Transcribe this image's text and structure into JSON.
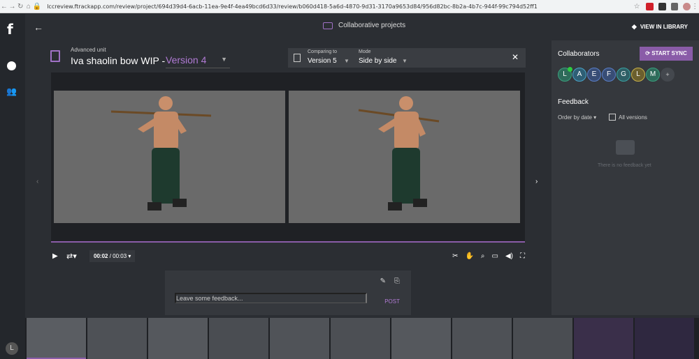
{
  "browser": {
    "url": "lccreview.ftrackapp.com/review/project/694d39d4-6acb-11ea-9e4f-4ea49bcd6d33/review/b060d418-5a6d-4870-9d31-3170a9653d84/956d82bc-8b2a-4b7c-944f-99c794d52ff1"
  },
  "app": {
    "logo": "f",
    "user_initial": "L"
  },
  "topbar": {
    "back_label": "←",
    "center_title": "Collaborative projects",
    "view_in_library": "VIEW IN LIBRARY"
  },
  "header": {
    "breadcrumb": "Advanced unit",
    "title": "Iva shaolin bow WIP -",
    "version": "Version 4"
  },
  "compare": {
    "comparing_label": "Comparing to",
    "comparing_value": "Version 5",
    "mode_label": "Mode",
    "mode_value": "Side by side",
    "close": "✕"
  },
  "controls": {
    "current_time": "00:02",
    "total_time": "/ 00:03"
  },
  "feedback_box": {
    "placeholder": "Leave some feedback...",
    "post_label": "POST"
  },
  "right_panel": {
    "collaborators_title": "Collaborators",
    "start_sync_label": "START SYNC",
    "avatars": [
      {
        "initial": "L",
        "color": "#3aa17e",
        "bg": "#2e6b5a",
        "online": true
      },
      {
        "initial": "A",
        "color": "#4aa3c8",
        "bg": "#2f5f75"
      },
      {
        "initial": "E",
        "color": "#5a7fc8",
        "bg": "#384d75"
      },
      {
        "initial": "F",
        "color": "#5a7fc8",
        "bg": "#384d75"
      },
      {
        "initial": "G",
        "color": "#3aa1a1",
        "bg": "#2e5f66"
      },
      {
        "initial": "L",
        "color": "#c8b24a",
        "bg": "#6b5f2e"
      },
      {
        "initial": "M",
        "color": "#3aa17e",
        "bg": "#2e6b5a"
      }
    ],
    "feedback_title": "Feedback",
    "order_label": "Order by date",
    "all_versions_label": "All versions",
    "no_feedback_text": "There is no feedback yet"
  },
  "colors": {
    "accent": "#8a5ca8",
    "accent_text": "#b07ad4",
    "panel": "#35383d",
    "background": "#2b2e33"
  }
}
